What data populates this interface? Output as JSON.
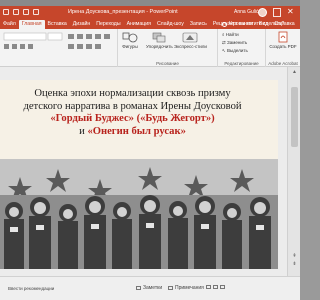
{
  "window": {
    "title": "Ирена Доускова_презентация  -  PowerPoint",
    "user_name": "Anna Gulić"
  },
  "tabs": [
    {
      "label": "Файл",
      "active": false
    },
    {
      "label": "Главная",
      "active": true
    },
    {
      "label": "Вставка",
      "active": false
    },
    {
      "label": "Дизайн",
      "active": false
    },
    {
      "label": "Переходы",
      "active": false
    },
    {
      "label": "Анимация",
      "active": false
    },
    {
      "label": "Слайд-шоу",
      "active": false
    },
    {
      "label": "Запись",
      "active": false
    },
    {
      "label": "Рецензирование",
      "active": false
    },
    {
      "label": "Вид",
      "active": false
    },
    {
      "label": "Справка",
      "active": false
    },
    {
      "label": "Acrobat",
      "active": false
    }
  ],
  "help_search": "Что вы хотите сделать?",
  "ribbon": {
    "figures_label": "Фигуры",
    "arrange_label": "Упорядочить",
    "quick_styles_label": "Экспресс-стили",
    "drawing_group": "Рисование",
    "find_label": "Найти",
    "replace_label": "Заменить",
    "select_label": "Выделить",
    "editing_group": "Редактирование",
    "create_pdf_label": "Создать PDF",
    "adobe_group": "Adobe Acrobat"
  },
  "slide": {
    "title_line1": "Оценка эпохи нормализации сквозь призму",
    "title_line2": "детского нарратива в романах Ирены Доусковой",
    "title_line3": "«Гордый Буджес» («Будь Жегорт»)",
    "title_line4_prefix": "и ",
    "title_line4_bold": "«Онегин был русак»"
  },
  "status": {
    "text": "Ввести рекомендации",
    "notes": "Заметки",
    "comments": "Примечания"
  },
  "colors": {
    "accent": "#c6462b",
    "title_red": "#b8231d"
  }
}
